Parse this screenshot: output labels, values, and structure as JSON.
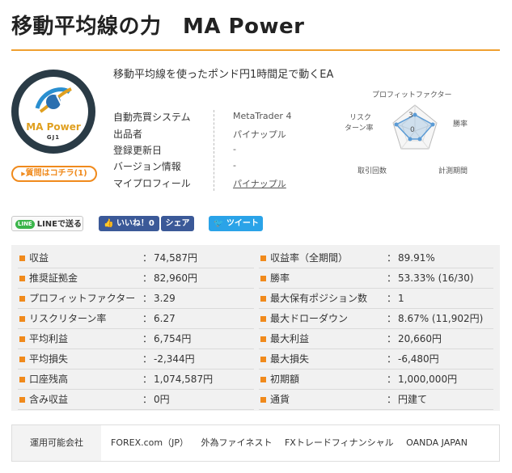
{
  "title": "移動平均線の力　MA Power",
  "logo": {
    "name": "MA Power",
    "sub": "GJ1"
  },
  "question_button": "質問はコチラ(1)",
  "description": "移動平均線を使ったポンド円1時間足で動くEA",
  "info": [
    {
      "label": "自動売買システム",
      "value": "MetaTrader 4"
    },
    {
      "label": "出品者",
      "value": "パイナップル"
    },
    {
      "label": "登録更新日",
      "value": "-"
    },
    {
      "label": "バージョン情報",
      "value": "-"
    },
    {
      "label": "マイプロフィール",
      "value": "パイナップル"
    }
  ],
  "radar": {
    "axes": [
      "プロフィットファクター",
      "勝率",
      "計測期間",
      "取引回数",
      "リスク\nリターン率"
    ],
    "scale_labels": [
      "3",
      "0"
    ],
    "labels": {
      "pf": "プロフィットファクター",
      "win": "勝率",
      "period": "計測期間",
      "trades": "取引回数",
      "rr1": "リスク",
      "rr2": "ターン率"
    }
  },
  "social": {
    "line": "LINEで送る",
    "line_badge": "LINE",
    "like": "いいね！0",
    "share": "シェア",
    "tweet": "ツイート"
  },
  "stats_left": [
    {
      "label": "収益",
      "value": "74,587円"
    },
    {
      "label": "推奨証拠金",
      "value": "82,960円"
    },
    {
      "label": "プロフィットファクター",
      "value": "3.29"
    },
    {
      "label": "リスクリターン率",
      "value": "6.27"
    },
    {
      "label": "平均利益",
      "value": "6,754円"
    },
    {
      "label": "平均損失",
      "value": "-2,344円"
    },
    {
      "label": "口座残高",
      "value": "1,074,587円"
    },
    {
      "label": "含み収益",
      "value": "0円"
    }
  ],
  "stats_right": [
    {
      "label": "収益率（全期間）",
      "value": "89.91%"
    },
    {
      "label": "勝率",
      "value": "53.33% (16/30)"
    },
    {
      "label": "最大保有ポジション数",
      "value": "1"
    },
    {
      "label": "最大ドローダウン",
      "value": "8.67% (11,902円)"
    },
    {
      "label": "最大利益",
      "value": "20,660円"
    },
    {
      "label": "最大損失",
      "value": "-6,480円"
    },
    {
      "label": "初期額",
      "value": "1,000,000円"
    },
    {
      "label": "通貨",
      "value": "円建て"
    }
  ],
  "colon": "：",
  "brokers": {
    "label": "運用可能会社",
    "items": [
      "FOREX.com（JP）",
      "外為ファイネスト",
      "FXトレードフィナンシャル",
      "OANDA JAPAN"
    ]
  },
  "colors": {
    "accent": "#f08a1c",
    "facebook": "#3b5998",
    "twitter": "#2aa3e8",
    "line": "#3ab54a",
    "radar": "#5b9bd5"
  }
}
